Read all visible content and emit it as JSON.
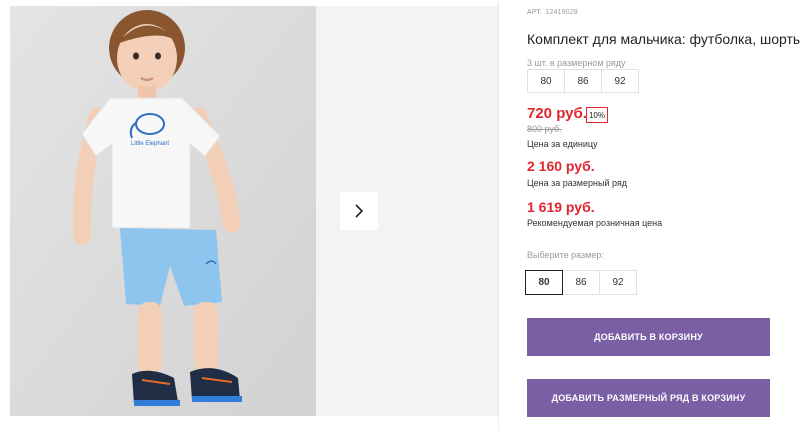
{
  "product": {
    "sku_label": "АРТ.",
    "sku": "12419028",
    "title": "Комплект для мальчика: футболка, шорты",
    "tshirt_text": "Little Elephant"
  },
  "size_row": {
    "label": "3 шт. в размерном ряду",
    "sizes": [
      "80",
      "86",
      "92"
    ]
  },
  "prices": {
    "unit_price": "720 руб.",
    "discount": "10%",
    "old_price": "800 руб.",
    "unit_label": "Цена за единицу",
    "row_price": "2 160 руб.",
    "row_label": "Цена за размерный ряд",
    "retail_price": "1 619 руб.",
    "retail_label": "Рекомендуемая розничная цена"
  },
  "size_picker": {
    "label": "Выберите размер:",
    "sizes": [
      "80",
      "86",
      "92"
    ],
    "selected": "80"
  },
  "buttons": {
    "add_to_cart": "ДОБАВИТЬ В КОРЗИНУ",
    "add_row_to_cart": "ДОБАВИТЬ РАЗМЕРНЫЙ РЯД В КОРЗИНУ"
  },
  "gallery": {
    "next_icon": "chevron-right-icon"
  },
  "colors": {
    "price_red": "#e1252f",
    "button_purple": "#7b5fa5"
  }
}
